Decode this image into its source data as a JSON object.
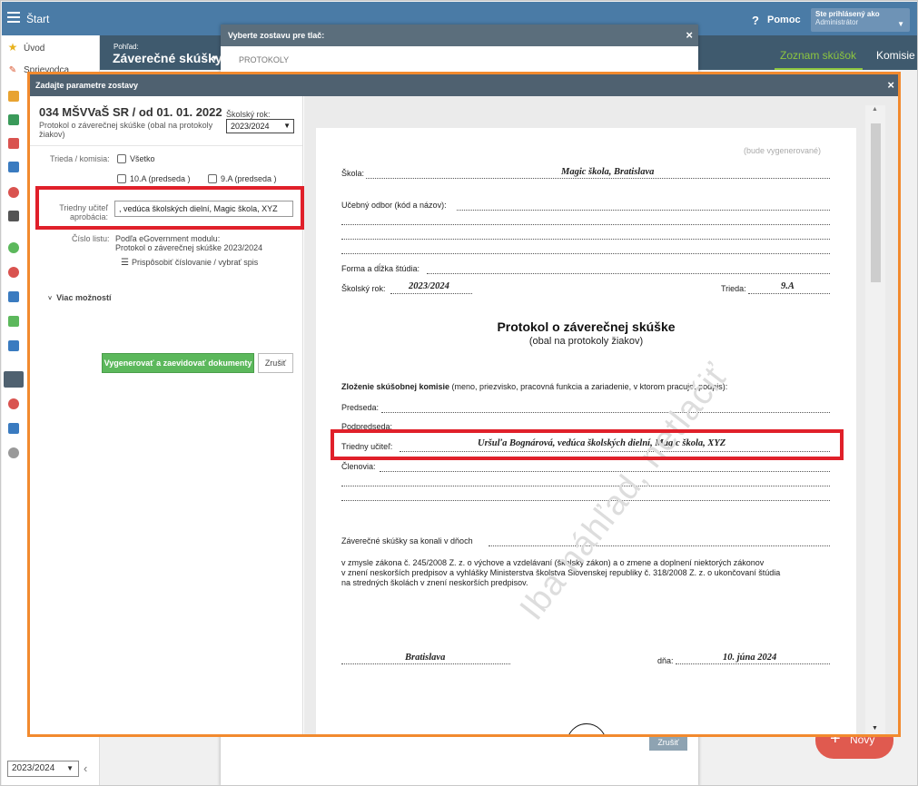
{
  "topbar": {
    "start": "Štart",
    "help": "Pomoc",
    "user_line1": "Ste prihlásený ako",
    "user_line2": "Administrátor"
  },
  "sidebar": {
    "items": [
      "Úvod",
      "Sprievodca"
    ],
    "year": "2023/2024"
  },
  "background": {
    "pohlad_label": "Pohľad:",
    "pohlad_title": "Záverečné skúšky",
    "tab_zoznam": "Zoznam skúšok",
    "tab_komisie": "Komisie",
    "novy": "Nový"
  },
  "print_dialog": {
    "title": "Vyberte zostavu pre tlač:",
    "subtitle": "PROTOKOLY",
    "cancel": "Zrušiť"
  },
  "modal": {
    "title": "Zadajte parametre zostavy",
    "org": "034 MŠVVaŠ SR / od 01. 01. 2022",
    "report_name": "Protokol o záverečnej skúške (obal na protokoly žiakov)",
    "year_label": "Školský rok:",
    "year_value": "2023/2024",
    "trieda_label": "Trieda / komisia:",
    "vsetko": "Všetko",
    "class1": "10.A (predseda )",
    "class2": "9.A (predseda )",
    "ucitel_label": "Triedny učiteľ aprobácia:",
    "ucitel_value": ", vedúca školských dielní, Magic škola, XYZ",
    "cislo_label": "Číslo listu:",
    "cislo_line1": "Podľa eGovernment modulu:",
    "cislo_line2": "Protokol o záverečnej skúške 2023/2024",
    "prisposobit": "Prispôsobiť číslovanie / vybrať spis",
    "viac": "Viac možností",
    "generate": "Vygenerovať a zaevidovať dokumenty",
    "cancel": "Zrušiť"
  },
  "preview": {
    "generated": "(bude vygenerované)",
    "skola_label": "Škola:",
    "skola_value": "Magic škola, Bratislava",
    "odbor_label": "Učebný odbor (kód a názov):",
    "forma_label": "Forma a dĺžka štúdia:",
    "rok_label": "Školský rok:",
    "rok_value": "2023/2024",
    "trieda_label": "Trieda:",
    "trieda_value": "9.A",
    "title": "Protokol o záverečnej skúške",
    "subtitle": "(obal na protokoly žiakov)",
    "zlozenie_bold": "Zloženie skúšobnej komisie",
    "zlozenie_rest": " (meno, priezvisko, pracovná funkcia a zariadenie, v ktorom pracuje, podpis):",
    "predseda": "Predseda:",
    "podpredseda": "Podpredseda:",
    "ucitel_label": "Triedny učiteľ:",
    "ucitel_value": "Uršuľa Bognárová, vedúca školských dielní, Magic škola, XYZ",
    "clenovia": "Členovia:",
    "konali": "Záverečné skúšky sa konali v dňoch",
    "zakon1": "v zmysle zákona č. 245/2008 Z. z. o výchove a vzdelávaní (školský zákon) a o zmene a doplnení niektorých zákonov",
    "zakon2": "v znení neskorších predpisov a vyhlášky Ministerstva školstva Slovenskej republiky č. 318/2008 Z. z. o ukončovaní štúdia",
    "zakon3": "na stredných školách v znení neskorších predpisov.",
    "miesto": "Bratislava",
    "dna_label": "dňa:",
    "datum": "10. júna 2024",
    "watermark": "Iba náhľad, netlačiť"
  }
}
